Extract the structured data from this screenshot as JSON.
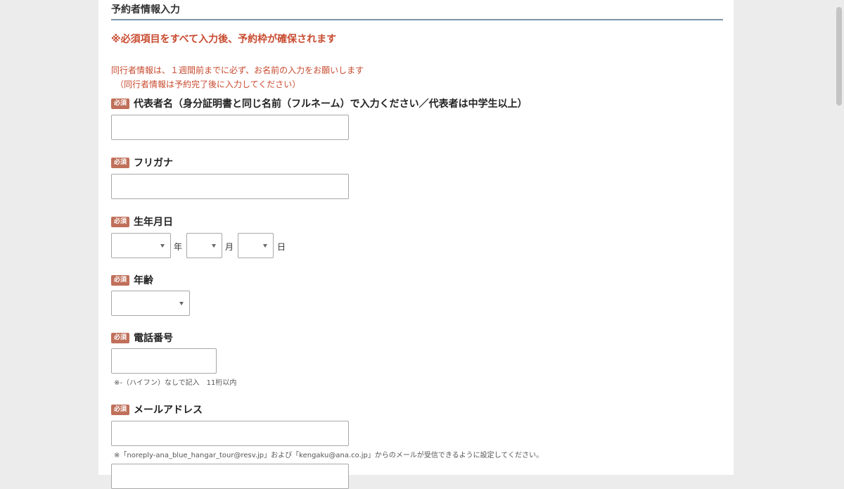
{
  "section": {
    "title": "予約者情報入力",
    "notice": "※必須項目をすべて入力後、予約枠が確保されます",
    "info_line1": "同行者情報は、１週間前までに必ず、お名前の入力をお願いします",
    "info_line2": "（同行者情報は予約完了後に入力してください）"
  },
  "required_badge": "必須",
  "fields": {
    "name": {
      "label": "代表者名（身分証明書と同じ名前（フルネーム）で入力ください／代表者は中学生以上）",
      "value": ""
    },
    "furigana": {
      "label": "フリガナ",
      "value": ""
    },
    "birthdate": {
      "label": "生年月日",
      "year_value": "",
      "year_unit": "年",
      "month_value": "",
      "month_unit": "月",
      "day_value": "",
      "day_unit": "日"
    },
    "age": {
      "label": "年齢",
      "value": ""
    },
    "phone": {
      "label": "電話番号",
      "value": "",
      "note": "※-（ハイフン）なしで記入　11桁以内"
    },
    "email": {
      "label": "メールアドレス",
      "value": "",
      "note": "※「noreply-ana_blue_hangar_tour@resv.jp」および「kengaku@ana.co.jp」からのメールが受信できるように設定してください。"
    },
    "email_confirm": {
      "value": ""
    }
  },
  "colors": {
    "accent_red": "#c84b30",
    "badge_bg": "#c0705a",
    "rule_blue": "#7b93a8"
  }
}
